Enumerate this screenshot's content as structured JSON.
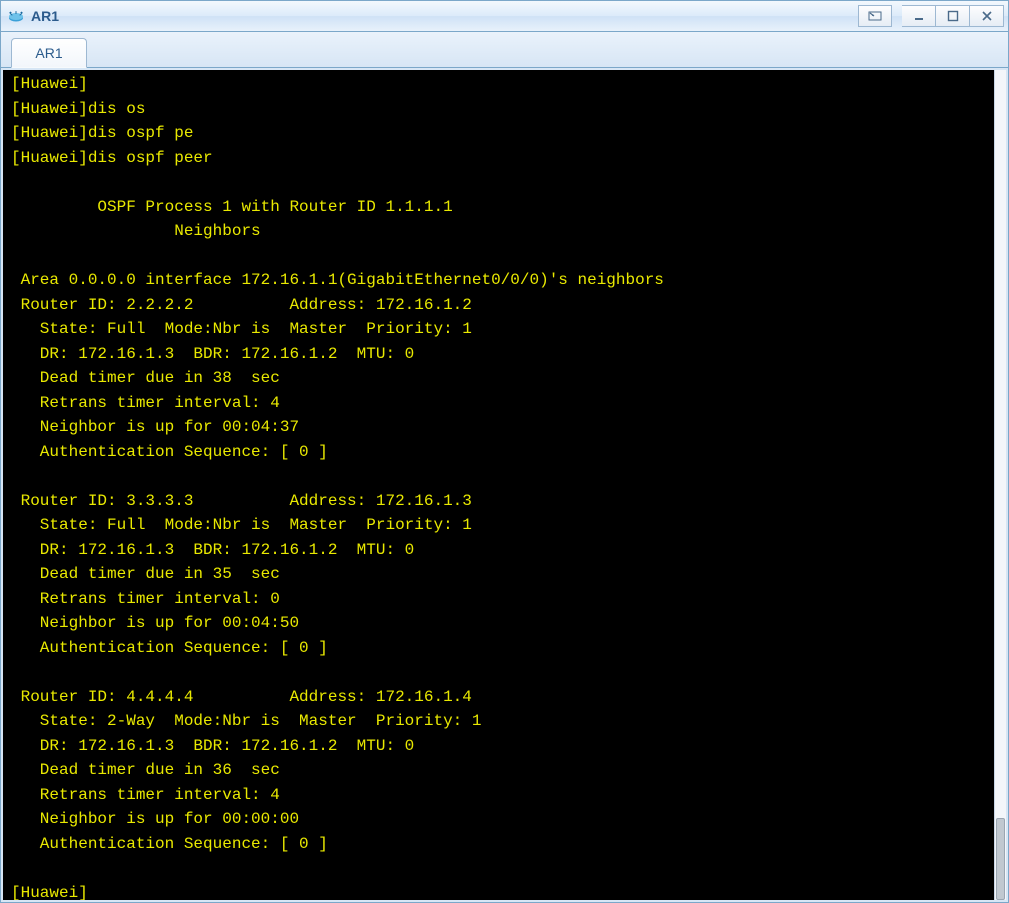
{
  "window": {
    "title": "AR1",
    "icon_name": "router-icon"
  },
  "tabs": [
    {
      "label": "AR1"
    }
  ],
  "terminal": {
    "lines": [
      "[Huawei]",
      "[Huawei]dis os",
      "[Huawei]dis ospf pe",
      "[Huawei]dis ospf peer",
      "",
      "\t OSPF Process 1 with Router ID 1.1.1.1",
      "\t\t Neighbors ",
      "",
      " Area 0.0.0.0 interface 172.16.1.1(GigabitEthernet0/0/0)'s neighbors",
      " Router ID: 2.2.2.2          Address: 172.16.1.2        ",
      "   State: Full  Mode:Nbr is  Master  Priority: 1",
      "   DR: 172.16.1.3  BDR: 172.16.1.2  MTU: 0    ",
      "   Dead timer due in 38  sec ",
      "   Retrans timer interval: 4 ",
      "   Neighbor is up for 00:04:37     ",
      "   Authentication Sequence: [ 0 ] ",
      "",
      " Router ID: 3.3.3.3          Address: 172.16.1.3        ",
      "   State: Full  Mode:Nbr is  Master  Priority: 1",
      "   DR: 172.16.1.3  BDR: 172.16.1.2  MTU: 0    ",
      "   Dead timer due in 35  sec ",
      "   Retrans timer interval: 0 ",
      "   Neighbor is up for 00:04:50     ",
      "   Authentication Sequence: [ 0 ] ",
      "",
      " Router ID: 4.4.4.4          Address: 172.16.1.4        ",
      "   State: 2-Way  Mode:Nbr is  Master  Priority: 1",
      "   DR: 172.16.1.3  BDR: 172.16.1.2  MTU: 0    ",
      "   Dead timer due in 36  sec ",
      "   Retrans timer interval: 4 ",
      "   Neighbor is up for 00:00:00     ",
      "   Authentication Sequence: [ 0 ] ",
      "",
      "[Huawei]"
    ]
  }
}
